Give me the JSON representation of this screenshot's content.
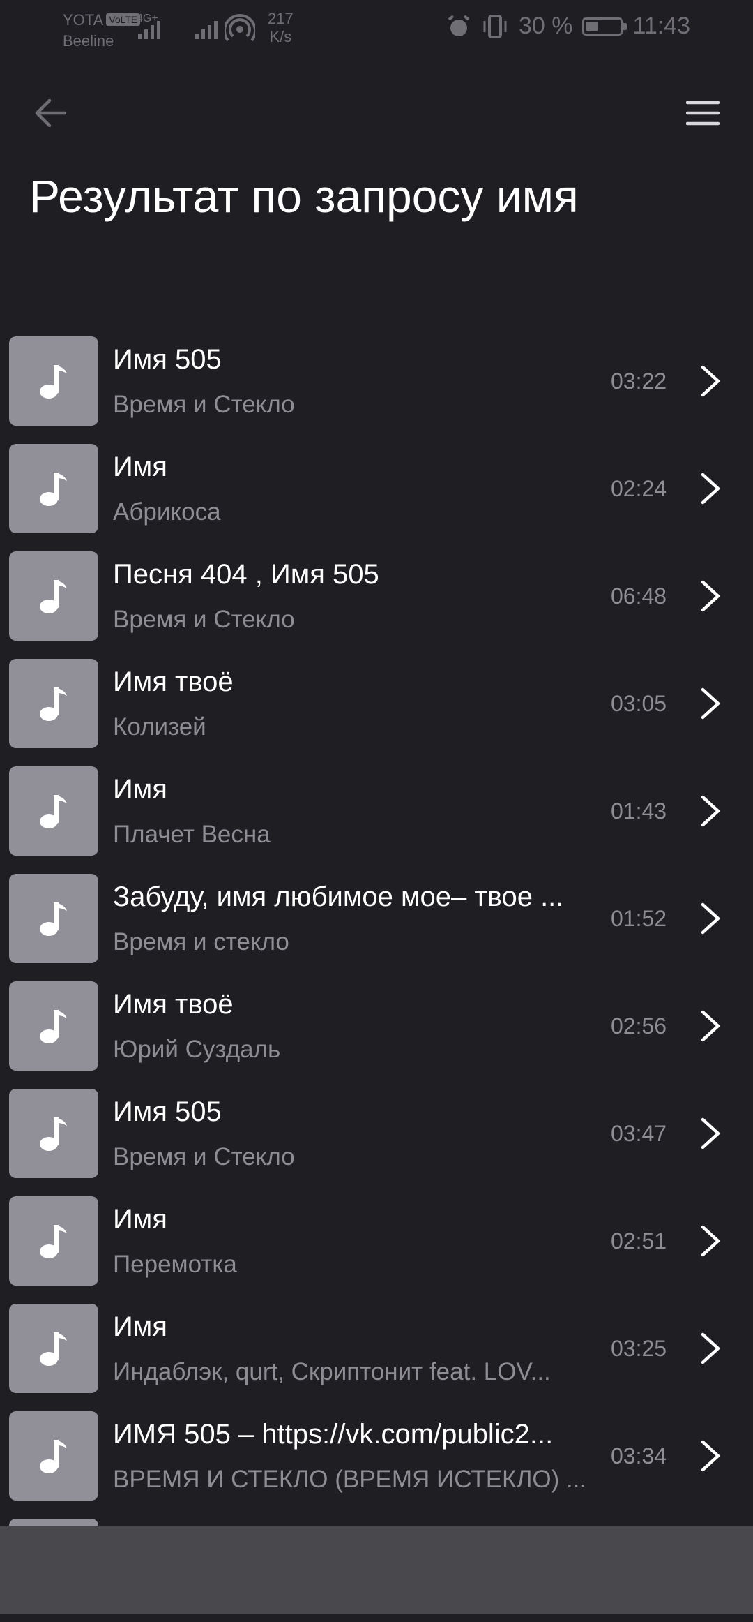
{
  "status_bar": {
    "carrier_1": "YOTA",
    "volte_badge": "VoLTE",
    "carrier_2": "Beeline",
    "network_type": "4G+",
    "net_speed_value": "217",
    "net_speed_unit": "K/s",
    "battery_text": "30 %",
    "battery_level": 0.3,
    "time": "11:43"
  },
  "header": {
    "back_icon": "arrow-left-icon",
    "menu_icon": "hamburger-menu-icon",
    "title": "Результат по запросу имя"
  },
  "tracks": [
    {
      "title": "Имя 505",
      "artist": "Время и Стекло",
      "duration": "03:22"
    },
    {
      "title": "Имя",
      "artist": "Абрикоса",
      "duration": "02:24"
    },
    {
      "title": "Песня 404 , Имя 505",
      "artist": "Время и Стекло",
      "duration": "06:48"
    },
    {
      "title": "Имя твоё",
      "artist": "Колизей",
      "duration": "03:05"
    },
    {
      "title": "Имя",
      "artist": "Плачет Весна",
      "duration": "01:43"
    },
    {
      "title": "Забуду, имя любимое мое– твое ...",
      "artist": "Время и стекло",
      "duration": "01:52"
    },
    {
      "title": "Имя твоё",
      "artist": "Юрий Суздаль",
      "duration": "02:56"
    },
    {
      "title": "Имя 505",
      "artist": "Время и Стекло",
      "duration": "03:47"
    },
    {
      "title": "Имя",
      "artist": "Перемотка",
      "duration": "02:51"
    },
    {
      "title": "Имя",
      "artist": "Индаблэк, qurt, Скриптонит feat. LOV...",
      "duration": "03:25"
    },
    {
      "title": "ИМЯ 505 – https://vk.com/public2...",
      "artist": "ВРЕМЯ И СТЕКЛО (ВРЕМЯ ИСТЕКЛО) ...",
      "duration": "03:34"
    }
  ],
  "colors": {
    "background": "#1f1e23",
    "thumbnail": "#918f97",
    "secondary_text": "#8e8d93",
    "bottom_panel": "#49484d"
  }
}
